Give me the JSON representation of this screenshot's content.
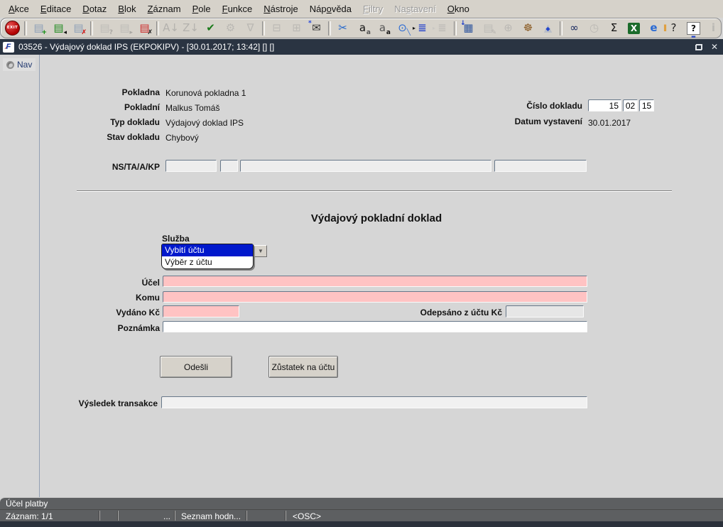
{
  "colors": {
    "required_field_pink": "#ffc3c3",
    "selection_blue": "#0018cc",
    "titlebar_navy": "#2a3442",
    "statusbar_gray": "#5d5f61",
    "chrome_gray": "#d6d2ca"
  },
  "menubar": {
    "items": [
      {
        "label": "Akce",
        "u": 0,
        "disabled": false
      },
      {
        "label": "Editace",
        "u": 0,
        "disabled": false
      },
      {
        "label": "Dotaz",
        "u": 0,
        "disabled": false
      },
      {
        "label": "Blok",
        "u": 0,
        "disabled": false
      },
      {
        "label": "Záznam",
        "u": 0,
        "disabled": false
      },
      {
        "label": "Pole",
        "u": 0,
        "disabled": false
      },
      {
        "label": "Funkce",
        "u": 0,
        "disabled": false
      },
      {
        "label": "Nástroje",
        "u": 0,
        "disabled": false
      },
      {
        "label": "Nápověda",
        "u": 3,
        "disabled": false
      },
      {
        "label": "Filtry",
        "u": 0,
        "disabled": true
      },
      {
        "label": "Nastavení",
        "u": 2,
        "disabled": true
      },
      {
        "label": "Okno",
        "u": 0,
        "disabled": false
      }
    ]
  },
  "toolbar": {
    "icons": [
      {
        "name": "exit-button",
        "type": "exit",
        "label": "EXIT",
        "enabled": true
      },
      {
        "sep": true
      },
      {
        "name": "insert-record-icon",
        "glyph": "▤",
        "color": "#8ea0b8",
        "overlay": "+",
        "ocolor": "#008800",
        "opos": "br",
        "enabled": true
      },
      {
        "name": "save-record-icon",
        "glyph": "▤",
        "color": "#1f8a1f",
        "overlay": "◂",
        "ocolor": "#111111",
        "opos": "br",
        "enabled": true
      },
      {
        "name": "delete-record-icon",
        "glyph": "▤",
        "color": "#8ea0b8",
        "overlay": "✗",
        "ocolor": "#cc0000",
        "opos": "br",
        "enabled": true
      },
      {
        "sep": true
      },
      {
        "name": "enter-query-icon",
        "glyph": "▤",
        "color": "#9aa4ae",
        "overlay": "?",
        "ocolor": "#777777",
        "opos": "br",
        "enabled": false
      },
      {
        "name": "execute-query-icon",
        "glyph": "▤",
        "color": "#9aa4ae",
        "overlay": "▸",
        "ocolor": "#777777",
        "opos": "br",
        "enabled": false
      },
      {
        "name": "cancel-query-icon",
        "glyph": "▤",
        "color": "#cc2a2a",
        "overlay": "✗",
        "ocolor": "#111111",
        "opos": "br",
        "enabled": true
      },
      {
        "sep": true
      },
      {
        "name": "sort-ascending-icon",
        "glyph": "A↓",
        "color": "#8a8a8a",
        "enabled": false
      },
      {
        "name": "sort-descending-icon",
        "glyph": "Z↓",
        "color": "#8a8a8a",
        "enabled": false
      },
      {
        "name": "accept-check-icon",
        "glyph": "✔",
        "color": "#1b7a1b",
        "enabled": true
      },
      {
        "name": "wrench-icon",
        "glyph": "⚙",
        "color": "#999999",
        "enabled": false
      },
      {
        "name": "filter-funnel-icon",
        "glyph": "∇",
        "color": "#999999",
        "enabled": false
      },
      {
        "sep": true
      },
      {
        "name": "print-icon",
        "glyph": "⊟",
        "color": "#999999",
        "enabled": false
      },
      {
        "name": "print-pages-icon",
        "glyph": "⊞",
        "color": "#999999",
        "enabled": false
      },
      {
        "name": "mail-icon",
        "glyph": "✉",
        "color": "#333333",
        "overlay": "*",
        "ocolor": "#2244dd",
        "opos": "tl",
        "enabled": true
      },
      {
        "sep": true
      },
      {
        "name": "cut-scissors-icon",
        "glyph": "✂",
        "color": "#2266cc",
        "enabled": true
      },
      {
        "name": "text-convert-icon",
        "glyph": "a",
        "color": "#111111",
        "overlay": "a",
        "ocolor": "#555555",
        "opos": "br",
        "enabled": true
      },
      {
        "name": "text-convert-back-icon",
        "glyph": "a",
        "color": "#555555",
        "overlay": "a",
        "ocolor": "#111111",
        "opos": "br",
        "enabled": true
      },
      {
        "name": "zoom-magnifier-icon",
        "glyph": "⊙",
        "color": "#2a6ad4",
        "overlay": "╲",
        "ocolor": "#2a6ad4",
        "opos": "br",
        "enabled": true
      },
      {
        "name": "list-of-values-icon",
        "glyph": "≣",
        "color": "#1133cc",
        "overlay": "▸",
        "ocolor": "#111111",
        "opos": "l",
        "enabled": true
      },
      {
        "name": "tree-list-icon",
        "glyph": "≣",
        "color": "#9a9a9a",
        "overlay": "▸",
        "ocolor": "#bbbbbb",
        "opos": "l",
        "enabled": false
      },
      {
        "sep": true
      },
      {
        "name": "clipboard-calendar-icon",
        "glyph": "▦",
        "color": "#33589e",
        "overlay": "↓",
        "ocolor": "#1133cc",
        "opos": "tl",
        "enabled": true
      },
      {
        "name": "edit-document-icon",
        "glyph": "▤",
        "color": "#9aa4ae",
        "overlay": "✎",
        "ocolor": "#888888",
        "opos": "br",
        "enabled": false
      },
      {
        "name": "globe-icon",
        "glyph": "⊕",
        "color": "#9a9a9a",
        "enabled": false
      },
      {
        "name": "helm-wheel-icon",
        "glyph": "☸",
        "color": "#8a5a22",
        "enabled": true
      },
      {
        "name": "alert-triangle-icon",
        "glyph": "▲",
        "color": "#b9bec7",
        "overlay": "◆",
        "ocolor": "#2244cc",
        "opos": "c",
        "enabled": true
      },
      {
        "sep": true
      },
      {
        "name": "binoculars-report-icon",
        "glyph": "∞",
        "color": "#15265e",
        "enabled": true
      },
      {
        "name": "clock-icon",
        "glyph": "◷",
        "color": "#999999",
        "enabled": false
      },
      {
        "name": "sum-sigma-icon",
        "glyph": "Σ",
        "color": "#111111",
        "enabled": true
      },
      {
        "name": "excel-export-icon",
        "glyph": "X",
        "color": "#ffffff",
        "bg": "#1b6b2a",
        "enabled": true
      },
      {
        "name": "browser-icon",
        "glyph": "e",
        "color": "#2a6ad4",
        "bold": true,
        "enabled": true
      },
      {
        "name": "help-values-icon",
        "glyph": "?",
        "color": "#222222",
        "overlay": "▌",
        "ocolor": "#e0a040",
        "opos": "l",
        "enabled": true
      },
      {
        "name": "help-boxed-icon",
        "glyph": "?",
        "color": "#111111",
        "border": true,
        "overlay": "▂",
        "ocolor": "#2244cc",
        "opos": "b",
        "enabled": true
      },
      {
        "name": "info-icon",
        "glyph": "i",
        "color": "#9a9a9a",
        "bold": true,
        "enabled": false
      }
    ]
  },
  "titlebar": {
    "title": "03526 - Výdajový doklad IPS (EKPOKIPV) - [30.01.2017; 13:42]  []  []",
    "icon_text": "F",
    "icon_slash": "⁄"
  },
  "navigator": {
    "tab_label": "Nav"
  },
  "form": {
    "info_rows": [
      {
        "label": "Pokladna",
        "value": "Korunová pokladna 1"
      },
      {
        "label": "Pokladní",
        "value": "Malkus Tomáš"
      },
      {
        "label": "Typ dokladu",
        "value": "Výdajový doklad IPS"
      },
      {
        "label": "Stav dokladu",
        "value": "Chybový"
      }
    ],
    "doc_number": {
      "label": "Číslo dokladu",
      "part1": "15",
      "part2": "02",
      "part3": "15"
    },
    "issue_date": {
      "label": "Datum vystavení",
      "value": "30.01.2017"
    },
    "ns": {
      "label": "NS/TA/A/KP",
      "f1": "",
      "f2": "",
      "f3": "",
      "f4": ""
    },
    "section_title": "Výdajový pokladní doklad",
    "service": {
      "label": "Služba",
      "selected": "Vybití účtu",
      "option2": "Výběr z účtu"
    },
    "ucel": {
      "label": "Účel",
      "value": ""
    },
    "komu": {
      "label": "Komu",
      "value": ""
    },
    "vydano": {
      "label": "Vydáno Kč",
      "value": ""
    },
    "odepsano": {
      "label": "Odepsáno z účtu Kč",
      "value": ""
    },
    "poznamka": {
      "label": "Poznámka",
      "value": ""
    },
    "buttons": {
      "send": "Odešli",
      "balance": "Zůstatek na účtu"
    },
    "vysledek": {
      "label": "Výsledek transakce",
      "value": ""
    }
  },
  "statusbar": {
    "message": "Účel platby",
    "record": "Záznam: 1/1",
    "ellipsis": "...",
    "list_indicator": "Seznam hodn...",
    "osc": "<OSC>"
  }
}
